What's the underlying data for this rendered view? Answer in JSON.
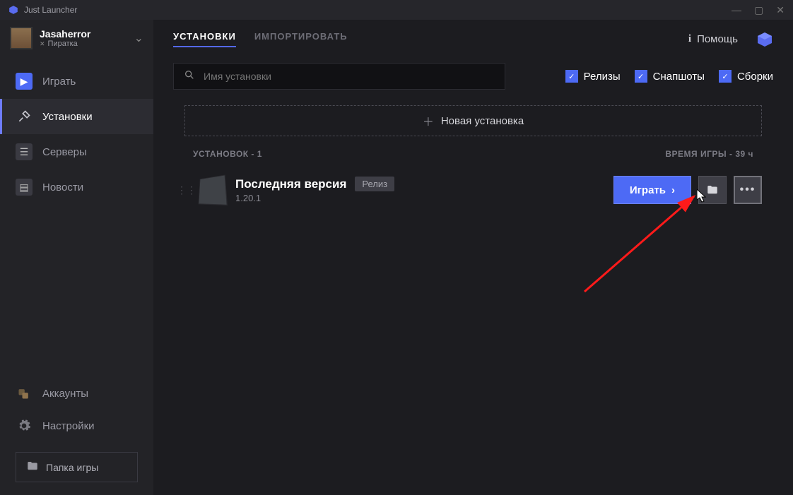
{
  "titlebar": {
    "title": "Just Launcher"
  },
  "profile": {
    "name": "Jasaherror",
    "subtitle": "Пиратка"
  },
  "sidebar": {
    "items": [
      {
        "label": "Играть"
      },
      {
        "label": "Установки"
      },
      {
        "label": "Серверы"
      },
      {
        "label": "Новости"
      }
    ],
    "bottom": [
      {
        "label": "Аккаунты"
      },
      {
        "label": "Настройки"
      }
    ],
    "folder_btn": "Папка игры"
  },
  "tabs": {
    "installs": "УСТАНОВКИ",
    "import": "ИМПОРТИРОВАТЬ"
  },
  "help": "Помощь",
  "search": {
    "placeholder": "Имя установки"
  },
  "filters": {
    "releases": "Релизы",
    "snapshots": "Снапшоты",
    "builds": "Сборки"
  },
  "new_install": "Новая установка",
  "stats": {
    "count_label": "УСТАНОВОК - 1",
    "playtime_label": "ВРЕМЯ ИГРЫ - 39 ч"
  },
  "install_row": {
    "title": "Последняя версия",
    "tag": "Релиз",
    "version": "1.20.1",
    "play": "Играть"
  }
}
